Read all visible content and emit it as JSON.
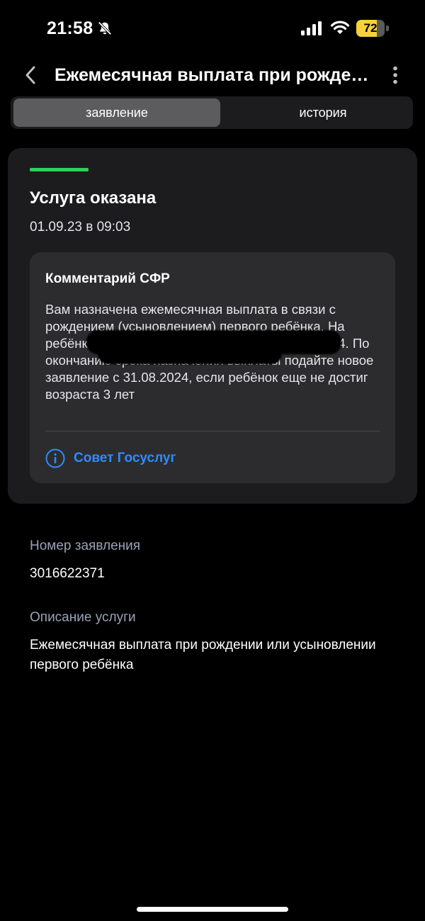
{
  "status_bar": {
    "time": "21:58",
    "battery_level": 72,
    "battery_label": "72"
  },
  "header": {
    "title": "Ежемесячная выплата при рождении или усыновлении первого ребёнка"
  },
  "tabs": [
    {
      "label": "заявление",
      "active": true
    },
    {
      "label": "история",
      "active": false
    }
  ],
  "status": {
    "title": "Услуга оказана",
    "datetime": "01.09.23 в 09:03",
    "indicator_color": "#30d158"
  },
  "comment": {
    "title": "Комментарий СФР",
    "text": "Вам назначена ежемесячная выплата в связи с рождением (усыновлением) первого ребёнка. На ребёнка размере руб. с 01.09.2023 по 31.08.2024. По окончанию срока назначения выплаты подайте новое заявление с 31.08.2024, если ребёнок еще не достиг возраста 3 лет",
    "tip_label": "Совет Госуслуг"
  },
  "application": {
    "number_label": "Номер заявления",
    "number": "3016622371",
    "description_label": "Описание услуги",
    "description": "Ежемесячная выплата при рождении или усыновлении первого ребёнка"
  },
  "colors": {
    "background": "#000000",
    "card": "#1c1c1e",
    "link": "#2d8cff",
    "success": "#30d158",
    "battery": "#f7d139"
  }
}
